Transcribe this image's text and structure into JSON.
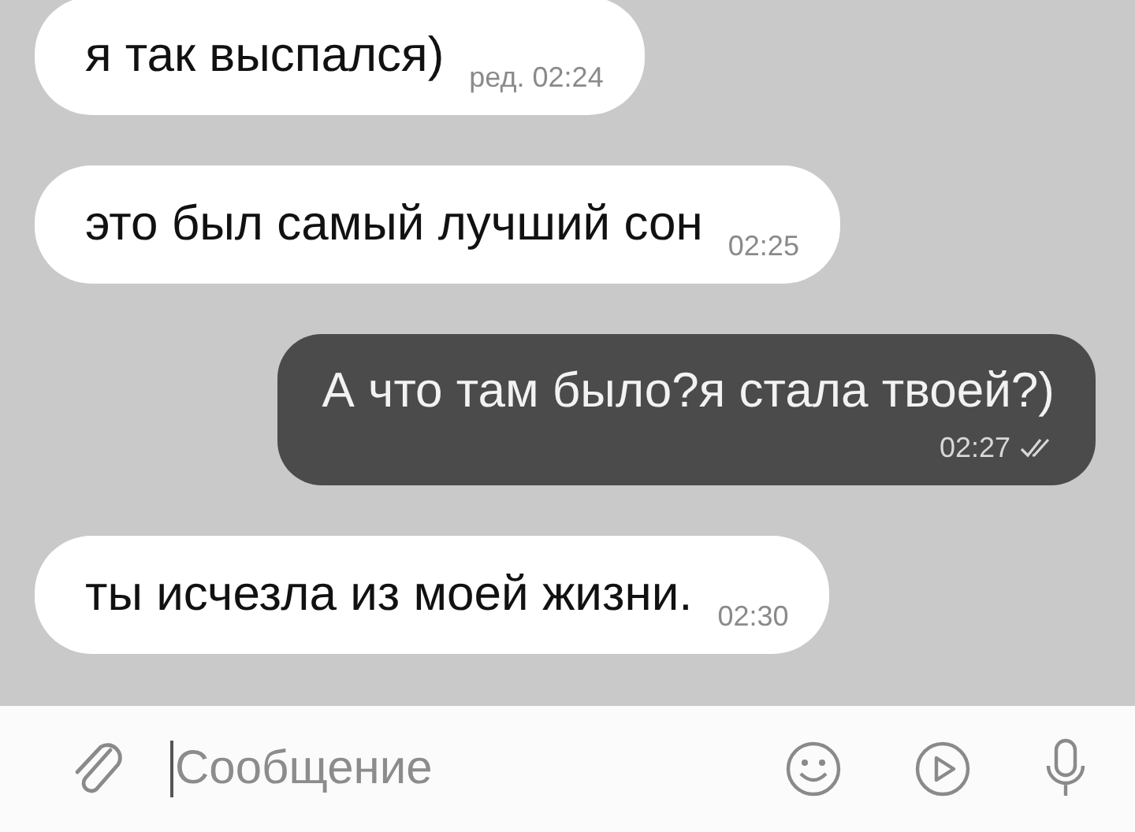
{
  "messages": [
    {
      "kind": "incoming",
      "text": "я так выспался)",
      "time": "ред. 02:24"
    },
    {
      "kind": "incoming",
      "text": "это был самый лучший сон",
      "time": "02:25"
    },
    {
      "kind": "outgoing",
      "text": "А что там было?я стала твоей?)",
      "time": "02:27",
      "read": true
    },
    {
      "kind": "incoming",
      "text": "ты исчезла из моей жизни.",
      "time": "02:30"
    }
  ],
  "composer": {
    "placeholder": "Сообщение"
  }
}
